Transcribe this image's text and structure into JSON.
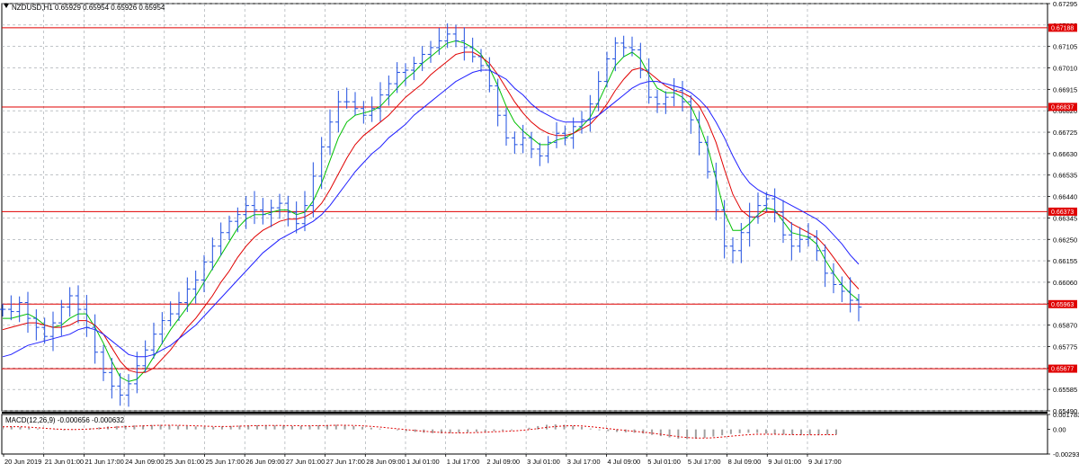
{
  "header": {
    "symbol_line": "NZDUSD,H1  0.65929 0.65954 0.65926 0.65954"
  },
  "colors": {
    "background": "#ffffff",
    "candles": "#1f4fe0",
    "ma_fast": "#00c000",
    "ma_mid": "#e00000",
    "ma_slow": "#2020ff",
    "level_line": "#e00000",
    "tag_fill": "#e00000",
    "grid": "#9aa0a6",
    "macd_hist": "#a0a0a0",
    "macd_signal": "#e00000"
  },
  "chart_data": [
    {
      "type": "line",
      "title": "NZDUSD,H1",
      "ohlc_last": {
        "open": 0.65929,
        "high": 0.65954,
        "low": 0.65926,
        "close": 0.65954
      },
      "ylim": [
        0.6549,
        0.67295
      ],
      "y_ticks": [
        "0.67295",
        "0.67200",
        "0.67105",
        "0.67010",
        "0.66915",
        "0.66820",
        "0.66725",
        "0.66630",
        "0.66535",
        "0.66440",
        "0.66345",
        "0.66250",
        "0.66155",
        "0.66060",
        "0.65965",
        "0.65870",
        "0.65775",
        "0.65680",
        "0.65585",
        "0.65490"
      ],
      "x_ticks": [
        "20 Jun 2019",
        "21 Jun 01:00",
        "21 Jun 17:00",
        "24 Jun 09:00",
        "25 Jun 01:00",
        "25 Jun 17:00",
        "26 Jun 09:00",
        "27 Jun 01:00",
        "27 Jun 17:00",
        "28 Jun 09:00",
        "1 Jul 01:00",
        "1 Jul 17:00",
        "2 Jul 09:00",
        "3 Jul 01:00",
        "3 Jul 17:00",
        "4 Jul 09:00",
        "5 Jul 01:00",
        "5 Jul 17:00",
        "8 Jul 09:00",
        "9 Jul 01:00",
        "9 Jul 17:00"
      ],
      "horizontal_levels": [
        {
          "value": 0.67188,
          "label": "0.67188"
        },
        {
          "value": 0.66837,
          "label": "0.66837"
        },
        {
          "value": 0.66373,
          "label": "0.66373"
        },
        {
          "value": 0.65963,
          "label": "0.65963"
        },
        {
          "value": 0.65677,
          "label": "0.65677"
        }
      ],
      "series": [
        {
          "type": "candles",
          "values": [
            0.6594,
            0.6593,
            0.6597,
            0.659,
            0.6586,
            0.6582,
            0.6588,
            0.6595,
            0.66,
            0.6594,
            0.6586,
            0.6575,
            0.6566,
            0.656,
            0.6556,
            0.6561,
            0.6569,
            0.6576,
            0.6583,
            0.6589,
            0.6592,
            0.6597,
            0.6603,
            0.6607,
            0.6615,
            0.6622,
            0.6628,
            0.6633,
            0.6636,
            0.664,
            0.6638,
            0.6636,
            0.6639,
            0.6641,
            0.6637,
            0.6632,
            0.664,
            0.6653,
            0.6666,
            0.6677,
            0.6686,
            0.6686,
            0.6683,
            0.668,
            0.6683,
            0.6689,
            0.6694,
            0.6699,
            0.67,
            0.6703,
            0.6707,
            0.671,
            0.6713,
            0.6716,
            0.6713,
            0.671,
            0.6706,
            0.6702,
            0.6693,
            0.668,
            0.667,
            0.6667,
            0.667,
            0.6665,
            0.6662,
            0.6668,
            0.6672,
            0.667,
            0.6675,
            0.6678,
            0.6685,
            0.6695,
            0.6705,
            0.6712,
            0.671,
            0.6709,
            0.67,
            0.6688,
            0.6685,
            0.6688,
            0.6691,
            0.6686,
            0.6678,
            0.6668,
            0.6655,
            0.6638,
            0.6622,
            0.662,
            0.6628,
            0.6635,
            0.664,
            0.6643,
            0.6637,
            0.6627,
            0.6622,
            0.6625,
            0.6626,
            0.662,
            0.661,
            0.6605,
            0.6602,
            0.6598,
            0.6595
          ]
        },
        {
          "name": "",
          "type": "ma",
          "values": [
            0.659,
            0.659,
            0.6591,
            0.6592,
            0.659,
            0.6587,
            0.6586,
            0.6587,
            0.659,
            0.6592,
            0.6592,
            0.6586,
            0.6579,
            0.6571,
            0.6564,
            0.6562,
            0.6563,
            0.6567,
            0.6573,
            0.6579,
            0.6585,
            0.659,
            0.6595,
            0.66,
            0.6606,
            0.6612,
            0.6618,
            0.6624,
            0.663,
            0.6634,
            0.6636,
            0.6636,
            0.6637,
            0.6638,
            0.6638,
            0.6636,
            0.6637,
            0.6642,
            0.665,
            0.666,
            0.667,
            0.6677,
            0.668,
            0.6681,
            0.6682,
            0.6684,
            0.6688,
            0.6692,
            0.6696,
            0.6699,
            0.6703,
            0.6706,
            0.6709,
            0.6712,
            0.6713,
            0.6712,
            0.671,
            0.6707,
            0.6701,
            0.6693,
            0.6684,
            0.6677,
            0.6673,
            0.667,
            0.6667,
            0.6667,
            0.6669,
            0.667,
            0.6672,
            0.6675,
            0.6679,
            0.6686,
            0.6694,
            0.6702,
            0.6706,
            0.6708,
            0.6705,
            0.6698,
            0.6692,
            0.669,
            0.669,
            0.6688,
            0.6684,
            0.6676,
            0.6666,
            0.6652,
            0.6637,
            0.6629,
            0.6629,
            0.6632,
            0.6636,
            0.6639,
            0.6638,
            0.6633,
            0.6628,
            0.6627,
            0.6626,
            0.6623,
            0.6616,
            0.661,
            0.6605,
            0.6601,
            0.6598
          ]
        },
        {
          "name": "",
          "type": "ma",
          "values": [
            0.6585,
            0.6586,
            0.6587,
            0.6588,
            0.6588,
            0.6587,
            0.6586,
            0.6586,
            0.6587,
            0.6589,
            0.6589,
            0.6587,
            0.6583,
            0.6577,
            0.6571,
            0.6567,
            0.6566,
            0.6566,
            0.6568,
            0.6572,
            0.6576,
            0.6581,
            0.6586,
            0.659,
            0.6595,
            0.66,
            0.6606,
            0.6611,
            0.6617,
            0.6622,
            0.6626,
            0.6629,
            0.6631,
            0.6633,
            0.6634,
            0.6634,
            0.6635,
            0.6637,
            0.6641,
            0.6647,
            0.6654,
            0.6661,
            0.6667,
            0.6671,
            0.6674,
            0.6677,
            0.668,
            0.6684,
            0.6688,
            0.6691,
            0.6694,
            0.6698,
            0.6701,
            0.6704,
            0.6707,
            0.6708,
            0.6708,
            0.6706,
            0.6703,
            0.6698,
            0.6692,
            0.6686,
            0.6681,
            0.6677,
            0.6674,
            0.6672,
            0.6671,
            0.6671,
            0.6672,
            0.6674,
            0.6676,
            0.668,
            0.6685,
            0.6691,
            0.6696,
            0.67,
            0.6701,
            0.6699,
            0.6696,
            0.6693,
            0.6691,
            0.669,
            0.6688,
            0.6684,
            0.6677,
            0.6668,
            0.6656,
            0.6645,
            0.6638,
            0.6635,
            0.6635,
            0.6637,
            0.6637,
            0.6635,
            0.6632,
            0.663,
            0.6628,
            0.6626,
            0.6622,
            0.6617,
            0.6612,
            0.6607,
            0.6603
          ]
        },
        {
          "name": "",
          "type": "ma",
          "values": [
            0.6573,
            0.6574,
            0.6576,
            0.6578,
            0.6579,
            0.658,
            0.6581,
            0.6582,
            0.6583,
            0.6585,
            0.6586,
            0.6585,
            0.6583,
            0.658,
            0.6577,
            0.6574,
            0.6573,
            0.6573,
            0.6574,
            0.6576,
            0.6578,
            0.6581,
            0.6584,
            0.6587,
            0.6591,
            0.6595,
            0.6599,
            0.6603,
            0.6607,
            0.6611,
            0.6615,
            0.6619,
            0.6622,
            0.6625,
            0.6627,
            0.6629,
            0.6631,
            0.6633,
            0.6636,
            0.664,
            0.6645,
            0.665,
            0.6655,
            0.6659,
            0.6663,
            0.6666,
            0.667,
            0.6673,
            0.6676,
            0.668,
            0.6683,
            0.6686,
            0.6689,
            0.6692,
            0.6695,
            0.6697,
            0.6699,
            0.67,
            0.67,
            0.6698,
            0.6696,
            0.6692,
            0.6689,
            0.6685,
            0.6682,
            0.668,
            0.6678,
            0.6677,
            0.6677,
            0.6677,
            0.6678,
            0.668,
            0.6683,
            0.6686,
            0.6689,
            0.6692,
            0.6694,
            0.6695,
            0.6695,
            0.6694,
            0.6693,
            0.6692,
            0.669,
            0.6687,
            0.6683,
            0.6677,
            0.667,
            0.6662,
            0.6655,
            0.665,
            0.6647,
            0.6645,
            0.6644,
            0.6642,
            0.664,
            0.6638,
            0.6636,
            0.6634,
            0.6631,
            0.6627,
            0.6623,
            0.6618,
            0.6614
          ]
        }
      ]
    },
    {
      "type": "bar",
      "title": "MACD(12,26,9) -0.000656 -0.000632",
      "ylim": [
        -0.002933,
        0.001783
      ],
      "y_ticks": [
        "0.001783",
        "0.00",
        "-0.002933"
      ],
      "series": [
        {
          "type": "histogram",
          "values": [
            0.0004,
            0.00035,
            0.0003,
            0.0002,
            0.0001,
            0.0,
            -5e-05,
            -0.0001,
            -5e-05,
            5e-05,
            0.00015,
            0.00025,
            0.00035,
            0.0004,
            0.00045,
            0.00048,
            0.0005,
            0.00052,
            0.00055,
            0.0005,
            0.00045,
            0.0004,
            0.00035,
            0.0003,
            0.0003,
            0.00035,
            0.0004,
            0.00045,
            0.00048,
            0.0005,
            0.0005,
            0.00048,
            0.00045,
            0.0004,
            0.0004,
            0.00045,
            0.0005,
            0.00052,
            0.00055,
            0.0005,
            0.0004,
            0.0003,
            0.0002,
            0.0001,
            0.0,
            -0.0001,
            -0.0002,
            -0.0003,
            -0.0004,
            -0.00045,
            -0.00048,
            -0.00045,
            -0.0004,
            -0.00035,
            -0.0003,
            -0.00025,
            -0.0002,
            -0.00015,
            -0.0001,
            0.0,
            0.0002,
            0.0004,
            0.00055,
            0.0006,
            0.00055,
            0.00045,
            0.0003,
            0.0001,
            -0.0001,
            -0.0002,
            -0.0003,
            -0.00035,
            -0.0004,
            -0.0005,
            -0.00065,
            -0.0008,
            -0.00095,
            -0.0011,
            -0.00115,
            -0.0011,
            -0.001,
            -0.00085,
            -0.0007,
            -0.00055,
            -0.00045,
            -0.0004,
            -0.00042,
            -0.0005,
            -0.00058,
            -0.00062,
            -0.00065,
            -0.00066,
            -0.00065,
            -0.00064,
            -0.00063,
            -0.00063
          ]
        },
        {
          "type": "signal",
          "values": [
            0.0003,
            0.00032,
            0.00031,
            0.00027,
            0.0002,
            0.00012,
            5e-05,
            0.0,
            -2e-05,
            0.0,
            5e-05,
            0.00012,
            0.0002,
            0.00027,
            0.00033,
            0.00038,
            0.00042,
            0.00046,
            0.00049,
            0.0005,
            0.00049,
            0.00046,
            0.00043,
            0.00039,
            0.00036,
            0.00035,
            0.00036,
            0.00039,
            0.00042,
            0.00045,
            0.00047,
            0.00047,
            0.00047,
            0.00045,
            0.00043,
            0.00043,
            0.00045,
            0.00047,
            0.0005,
            0.0005,
            0.00048,
            0.00043,
            0.00036,
            0.00028,
            0.00018,
            8e-05,
            -3e-05,
            -0.00013,
            -0.00022,
            -0.0003,
            -0.00036,
            -0.0004,
            -0.00041,
            -0.0004,
            -0.00037,
            -0.00033,
            -0.00029,
            -0.00024,
            -0.00019,
            -0.00012,
            -3e-05,
            0.0001,
            0.00024,
            0.00035,
            0.00042,
            0.00044,
            0.00041,
            0.00033,
            0.00022,
            0.0001,
            -2e-05,
            -0.00013,
            -0.00023,
            -0.00033,
            -0.00045,
            -0.00058,
            -0.00072,
            -0.00086,
            -0.00097,
            -0.00103,
            -0.00104,
            -0.00099,
            -0.00091,
            -0.00081,
            -0.00071,
            -0.00063,
            -0.00058,
            -0.00057,
            -0.00058,
            -0.0006,
            -0.00062,
            -0.00064,
            -0.00064,
            -0.00064,
            -0.00063,
            -0.00063
          ]
        }
      ]
    }
  ]
}
